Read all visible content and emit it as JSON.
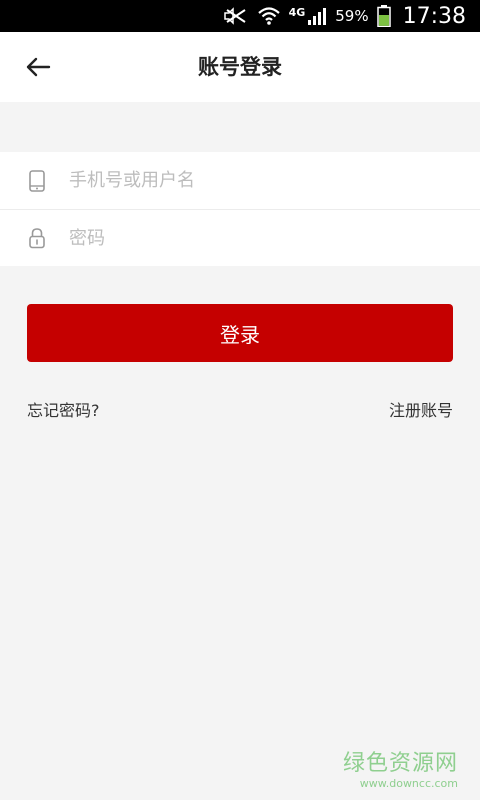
{
  "status_bar": {
    "network": "4G",
    "battery_percent": "59%",
    "time": "17:38"
  },
  "header": {
    "title": "账号登录"
  },
  "form": {
    "username_placeholder": "手机号或用户名",
    "password_placeholder": "密码"
  },
  "login_button": "登录",
  "links": {
    "forgot_password": "忘记密码?",
    "register": "注册账号"
  },
  "watermark": {
    "brand": "绿色资源网",
    "url": "www.downcc.com"
  },
  "colors": {
    "accent": "#c50000",
    "background": "#f4f4f4",
    "placeholder": "#bdbdbd",
    "watermark": "#8fcf8f"
  }
}
